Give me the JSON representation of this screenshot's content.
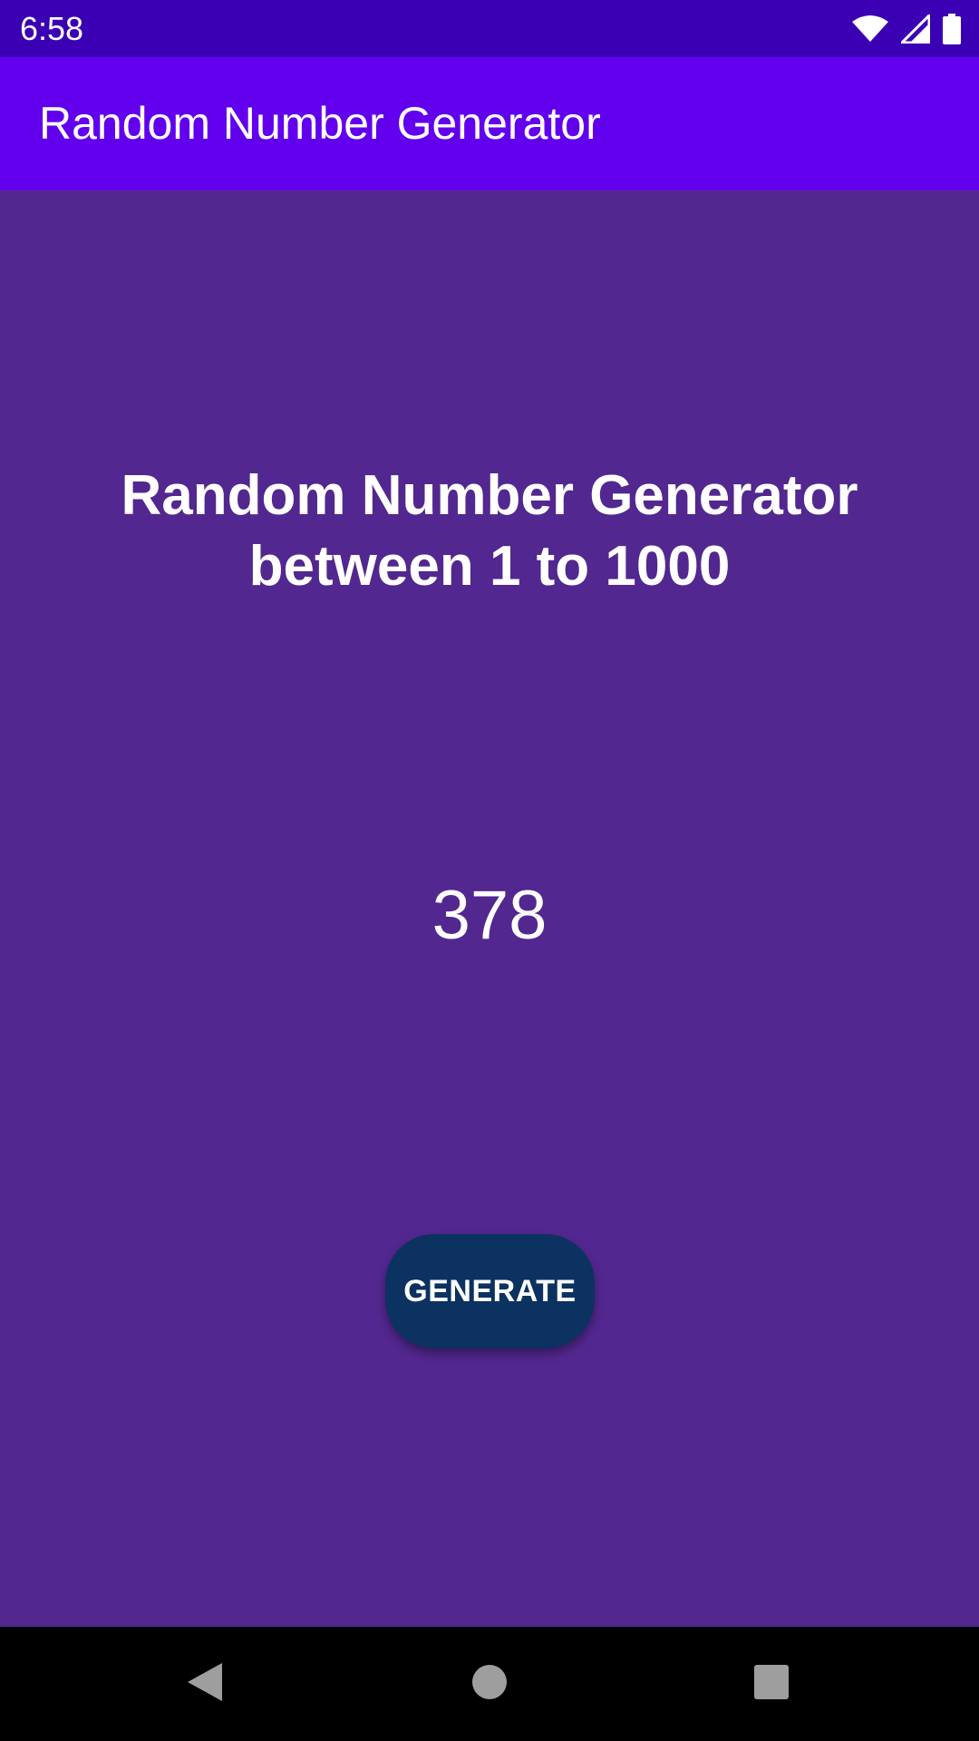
{
  "status_bar": {
    "time": "6:58",
    "icons": [
      "wifi-icon",
      "cell-signal-icon",
      "battery-icon"
    ]
  },
  "app_bar": {
    "title": "Random Number Generator"
  },
  "main": {
    "heading_line1": "Random Number Generator",
    "heading_line2": "between 1 to 1000",
    "number": "378",
    "generate_label": "GENERATE"
  },
  "nav_bar": {
    "icons": [
      "back-icon",
      "home-icon",
      "recents-icon"
    ]
  },
  "colors": {
    "status_bar": "#3B00B3",
    "app_bar": "#6200EE",
    "background": "#52278F",
    "button": "#0B3260",
    "text": "#FFFFFF"
  }
}
